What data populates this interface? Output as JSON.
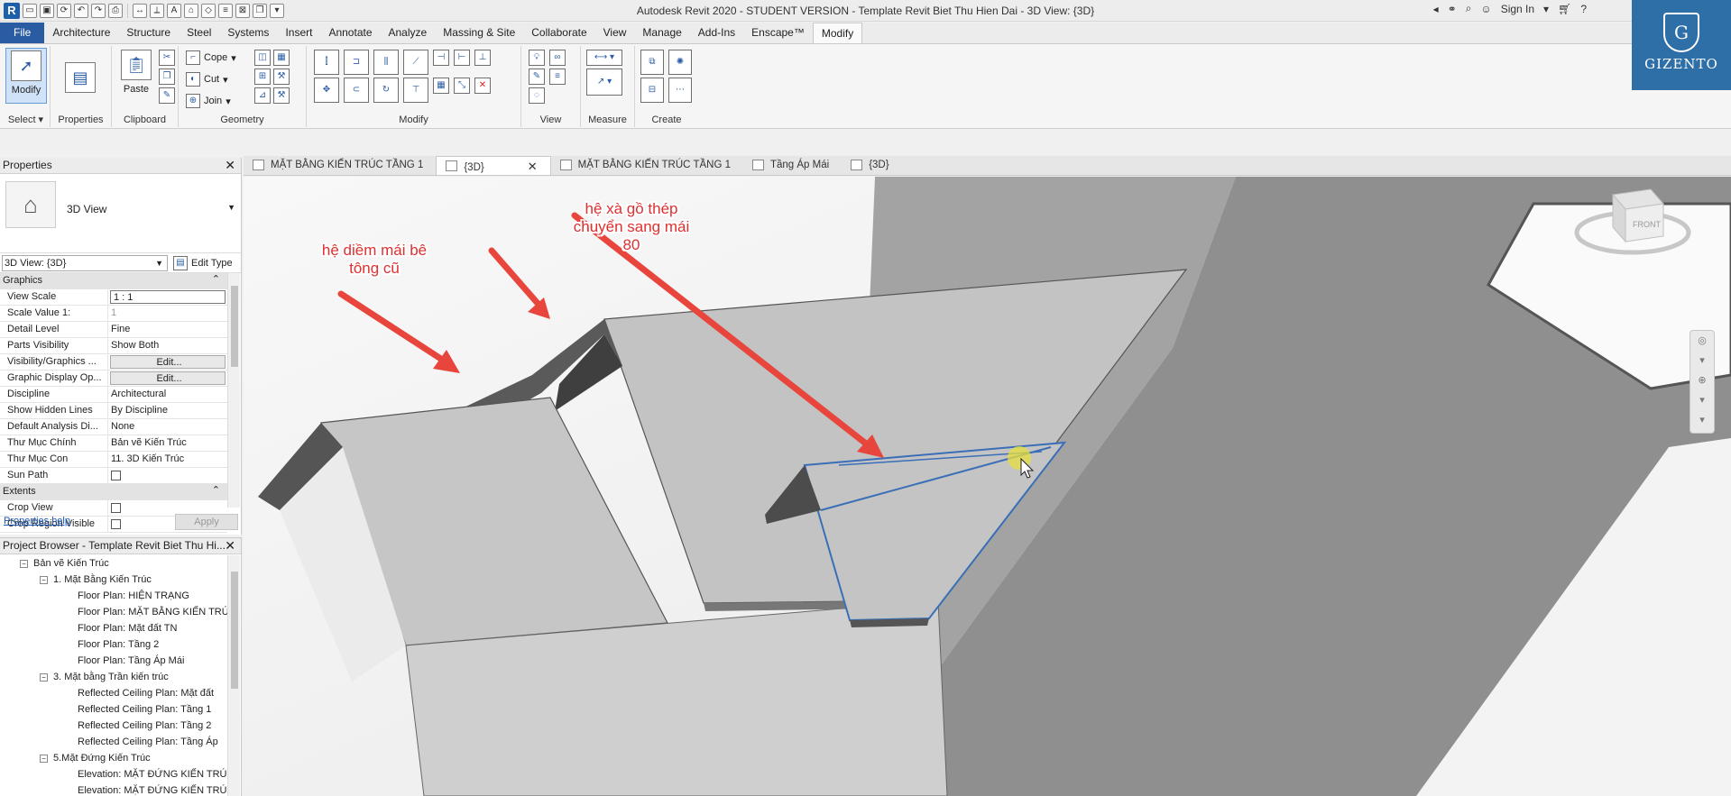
{
  "app": {
    "title": "Autodesk Revit 2020 - STUDENT VERSION - Template Revit Biet Thu Hien Dai - 3D View: {3D}",
    "sign_in": "Sign In"
  },
  "ribbon": {
    "tabs": [
      "File",
      "Architecture",
      "Structure",
      "Steel",
      "Systems",
      "Insert",
      "Annotate",
      "Analyze",
      "Massing & Site",
      "Collaborate",
      "View",
      "Manage",
      "Add-Ins",
      "Enscape™",
      "Modify"
    ],
    "active_tab": "Modify",
    "groups": {
      "select": "Select",
      "properties": "Properties",
      "clipboard": "Clipboard",
      "geometry": "Geometry",
      "modify": "Modify",
      "view": "View",
      "measure": "Measure",
      "create": "Create"
    },
    "buttons": {
      "modify": "Modify",
      "paste": "Paste",
      "cope": "Cope",
      "cut": "Cut",
      "join": "Join"
    }
  },
  "logo": {
    "name": "GIZENTO",
    "letter": "G"
  },
  "properties": {
    "header": "Properties",
    "type_name": "3D View",
    "instance": "3D View: {3D}",
    "edit_type": "Edit Type",
    "rows": [
      {
        "kind": "section",
        "name": "Graphics"
      },
      {
        "name": "View Scale",
        "value": "1 : 1",
        "style": "box"
      },
      {
        "name": "Scale Value    1:",
        "value": "1",
        "style": "grey",
        "grey": true
      },
      {
        "name": "Detail Level",
        "value": "Fine"
      },
      {
        "name": "Parts Visibility",
        "value": "Show Both"
      },
      {
        "name": "Visibility/Graphics ...",
        "value": "Edit...",
        "style": "btn"
      },
      {
        "name": "Graphic Display Op...",
        "value": "Edit...",
        "style": "btn"
      },
      {
        "name": "Discipline",
        "value": "Architectural"
      },
      {
        "name": "Show Hidden Lines",
        "value": "By Discipline"
      },
      {
        "name": "Default Analysis Di...",
        "value": "None"
      },
      {
        "name": "Thư Mục Chính",
        "value": "Bản vẽ Kiến Trúc"
      },
      {
        "name": "Thư Mục Con",
        "value": "11. 3D Kiến Trúc"
      },
      {
        "name": "Sun Path",
        "value": "",
        "style": "check"
      },
      {
        "kind": "section",
        "name": "Extents"
      },
      {
        "name": "Crop View",
        "value": "",
        "style": "check"
      },
      {
        "name": "Crop Region Visible",
        "value": "",
        "style": "check"
      }
    ],
    "help": "Properties help",
    "apply": "Apply"
  },
  "browser": {
    "header": "Project Browser - Template Revit Biet Thu Hi...",
    "nodes": [
      {
        "level": 1,
        "toggle": "−",
        "label": "Bản vẽ Kiến Trúc"
      },
      {
        "level": 2,
        "toggle": "−",
        "label": "1. Mặt Bằng Kiến Trúc"
      },
      {
        "level": 3,
        "label": "Floor Plan: HIỆN TRẠNG"
      },
      {
        "level": 3,
        "label": "Floor Plan: MẶT BẰNG KIẾN TRÚ"
      },
      {
        "level": 3,
        "label": "Floor Plan: Mặt đất TN"
      },
      {
        "level": 3,
        "label": "Floor Plan: Tầng 2"
      },
      {
        "level": 3,
        "label": "Floor Plan: Tầng Áp Mái"
      },
      {
        "level": 2,
        "toggle": "−",
        "label": "3. Mặt bằng Trần kiến trúc"
      },
      {
        "level": 3,
        "label": "Reflected Ceiling Plan: Mặt đất"
      },
      {
        "level": 3,
        "label": "Reflected Ceiling Plan: Tầng 1"
      },
      {
        "level": 3,
        "label": "Reflected Ceiling Plan: Tầng 2"
      },
      {
        "level": 3,
        "label": "Reflected Ceiling Plan: Tầng Áp"
      },
      {
        "level": 2,
        "toggle": "−",
        "label": "5.Mặt Đứng Kiến Trúc"
      },
      {
        "level": 3,
        "label": "Elevation: MẶT ĐỨNG KIẾN TRÚ"
      },
      {
        "level": 3,
        "label": "Elevation: MẶT ĐỨNG KIẾN TRÚ"
      }
    ]
  },
  "view_tabs": [
    {
      "label": "MẶT BẰNG KIẾN TRÚC TẦNG 1",
      "active": false
    },
    {
      "label": "{3D}",
      "active": true
    },
    {
      "label": "MẶT BẰNG KIẾN TRÚC TẦNG 1",
      "active": false
    },
    {
      "label": "Tầng Áp Mái",
      "active": false
    },
    {
      "label": "{3D}",
      "active": false
    }
  ],
  "annotations": {
    "left": "hệ diềm mái bê\ntông cũ",
    "right": "hệ xà gồ thép\nchuyển sang mái\n80"
  },
  "viewcube": {
    "face": "FRONT"
  },
  "colors": {
    "accent": "#2a5ca3",
    "annotation": "#e03030",
    "arrow": "#e8453c"
  }
}
